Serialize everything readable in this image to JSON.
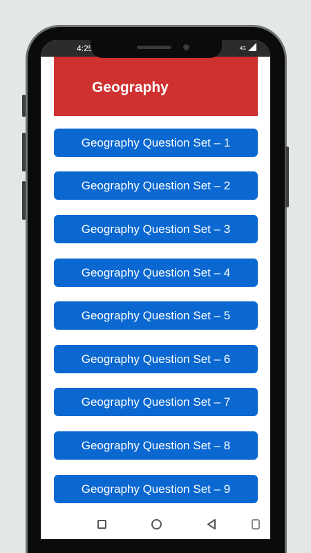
{
  "status_bar": {
    "time": "4:25",
    "network_label": "4G"
  },
  "header": {
    "title": "Geography"
  },
  "question_sets": [
    "Geography Question Set – 1",
    "Geography Question Set – 2",
    "Geography Question Set – 3",
    "Geography Question Set – 4",
    "Geography Question Set – 5",
    "Geography Question Set – 6",
    "Geography Question Set – 7",
    "Geography Question Set – 8",
    "Geography Question Set – 9"
  ],
  "colors": {
    "header_bg": "#cf3030",
    "button_bg": "#0b68d0",
    "button_text": "#ffffff"
  },
  "nav_icons": [
    "recent-apps-icon",
    "home-icon",
    "back-icon",
    "rotate-icon"
  ]
}
